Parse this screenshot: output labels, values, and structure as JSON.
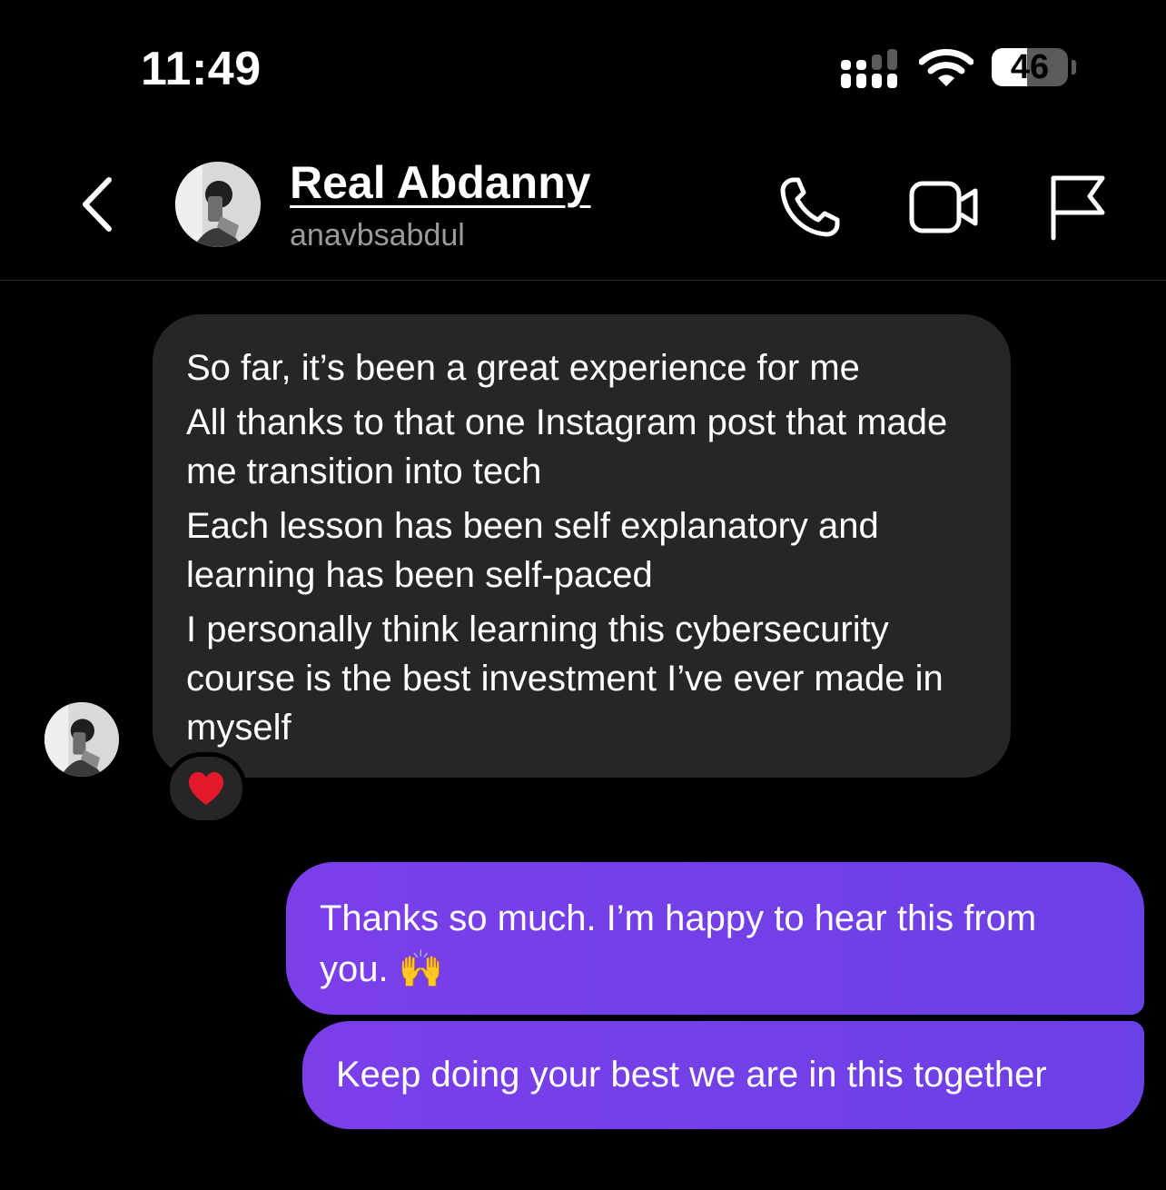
{
  "status_bar": {
    "time": "11:49",
    "battery": "46",
    "battery_level": 0.46
  },
  "header": {
    "display_name": "Real Abdanny",
    "username": "anavbsabdul"
  },
  "messages": {
    "incoming": {
      "lines": [
        "So far, it’s been a great experience for me",
        "All thanks to that one Instagram post that made me transition into tech",
        "Each lesson has been self explanatory and learning has been self-paced",
        "I personally think learning this cybersecurity course is the best investment I’ve ever made in myself"
      ],
      "reaction": "❤️"
    },
    "outgoing": [
      {
        "text": "Thanks so much. I’m happy to hear this from you.",
        "emoji": "🙌"
      },
      {
        "text": "Keep doing your best we are in this together"
      }
    ]
  },
  "icons": {
    "back": "chevron-left-icon",
    "call": "phone-icon",
    "video": "video-camera-icon",
    "report": "flag-icon"
  }
}
